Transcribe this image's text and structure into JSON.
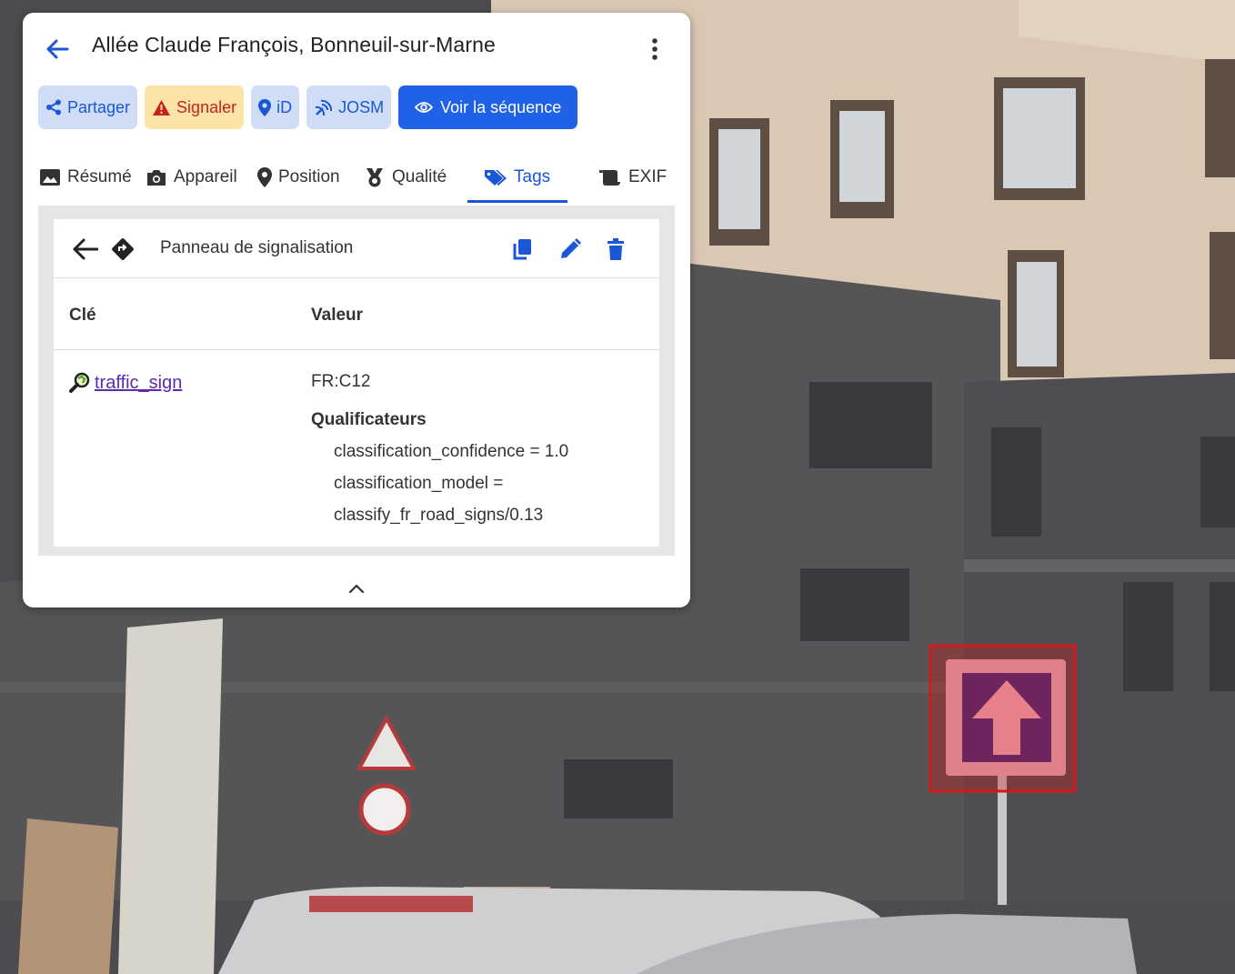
{
  "header": {
    "title": "Allée Claude François, Bonneuil-sur-Marne"
  },
  "actions": {
    "share": "Partager",
    "report": "Signaler",
    "id": "iD",
    "josm": "JOSM",
    "sequence": "Voir la séquence"
  },
  "tabs": [
    {
      "label": "Résumé",
      "icon": "image-icon"
    },
    {
      "label": "Appareil",
      "icon": "camera-icon"
    },
    {
      "label": "Position",
      "icon": "map-pin-icon"
    },
    {
      "label": "Qualité",
      "icon": "medal-icon"
    },
    {
      "label": "Tags",
      "icon": "tags-icon",
      "active": true
    },
    {
      "label": "EXIF",
      "icon": "scroll-icon"
    }
  ],
  "tag_card": {
    "title": "Panneau de signalisation",
    "col_key": "Clé",
    "col_value": "Valeur",
    "row": {
      "key": "traffic_sign",
      "value": "FR:C12",
      "qualifiers_title": "Qualificateurs",
      "qualifiers": [
        "classification_confidence = 1.0",
        "classification_model =",
        "classify_fr_road_signs/0.13"
      ]
    }
  },
  "colors": {
    "accent": "#1f62e8",
    "accent_text": "#1a56d6",
    "report_bg": "#fde3a6",
    "report_text": "#c5221f",
    "detection_box": "#d11a1a"
  }
}
